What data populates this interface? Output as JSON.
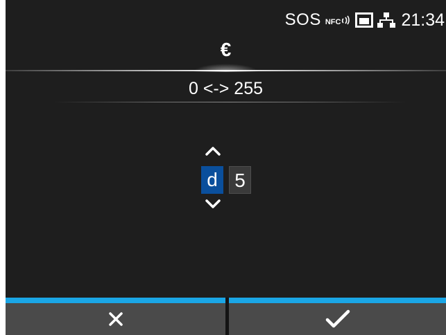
{
  "status_bar": {
    "sos": "SOS",
    "nfc": "NFC",
    "icons": [
      "nfc-icon",
      "sd-card-icon",
      "network-icon"
    ],
    "clock": "21:34"
  },
  "title": "€",
  "range": "0 <-> 255",
  "spinner": {
    "digits": [
      "d",
      "5"
    ],
    "active_index": 0
  },
  "buttons": {
    "cancel_icon": "close-icon",
    "confirm_icon": "check-icon"
  },
  "colors": {
    "background": "#1e1e1e",
    "accent_blue": "#1aa6e6",
    "active_digit": "#0a4f9c",
    "button": "#4a4a4a"
  }
}
